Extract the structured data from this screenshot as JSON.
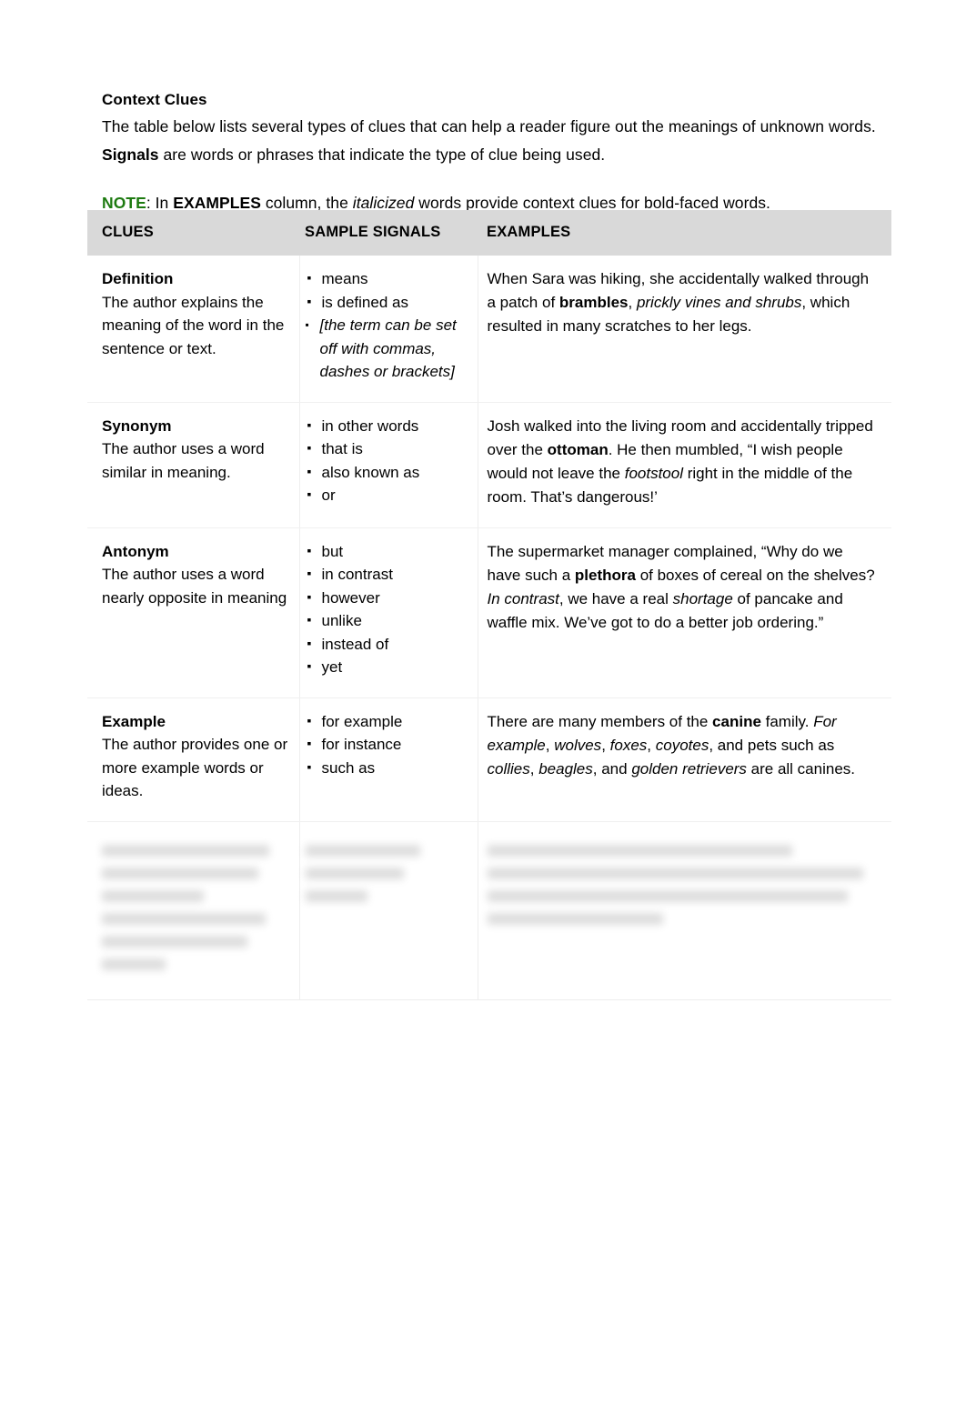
{
  "document": {
    "title": "Context Clues",
    "intro_part1": "The table below lists several types of clues that can help a reader figure out the meanings of unknown words.  ",
    "intro_bold": "Signals",
    "intro_part2": " are words or phrases that indicate the type of clue being used.",
    "note_label": "NOTE",
    "note_part1": ": In ",
    "note_bold": "EXAMPLES",
    "note_part2": " column, the ",
    "note_italic": "italicized",
    "note_part3": " words provide context clues for bold-faced words.",
    "note_color": "#1d7a10"
  },
  "table": {
    "headers": {
      "clues": "CLUES",
      "signals": "SAMPLE SIGNALS",
      "examples": "EXAMPLES"
    },
    "rows": [
      {
        "clue_name": "Definition",
        "clue_desc": "The author explains the meaning of the word in the sentence or text.",
        "signals": [
          {
            "text": "means",
            "italic": false
          },
          {
            "text": "is defined as",
            "italic": false
          },
          {
            "text": "[the term can be set off with commas, dashes or brackets]",
            "italic": true
          }
        ],
        "example": {
          "p1": "When Sara was hiking, she accidentally walked through a patch of ",
          "bold1": "brambles",
          "p2": ", ",
          "italic1": "prickly vines and shrubs",
          "p3": ", which resulted in many scratches to her legs."
        }
      },
      {
        "clue_name": "Synonym",
        "clue_desc": "The author uses a word similar in meaning.",
        "signals": [
          {
            "text": "in other words",
            "italic": false
          },
          {
            "text": "that is",
            "italic": false
          },
          {
            "text": "also known as",
            "italic": false
          },
          {
            "text": "or",
            "italic": false
          }
        ],
        "example": {
          "p1": "Josh walked into the living room and accidentally tripped over the ",
          "bold1": "ottoman",
          "p2": ".  He then mumbled, “I wish people would not leave the ",
          "italic1": "footstool",
          "p3": " right in the middle of the room.  That’s dangerous!’"
        }
      },
      {
        "clue_name": "Antonym",
        "clue_desc": "The author uses a word nearly opposite in meaning",
        "signals": [
          {
            "text": "but",
            "italic": false
          },
          {
            "text": "in contrast",
            "italic": false
          },
          {
            "text": "however",
            "italic": false
          },
          {
            "text": "unlike",
            "italic": false
          },
          {
            "text": "instead of",
            "italic": false
          },
          {
            "text": "yet",
            "italic": false
          }
        ],
        "example": {
          "p1": "The supermarket manager complained, “Why do we have such a ",
          "bold1": "plethora",
          "p2": " of boxes of cereal on the shelves?  ",
          "italic1": "In contrast",
          "p3": ", we have a real ",
          "italic2": "shortage",
          "p4": " of pancake and waffle mix. We’ve got to do a better job ordering.”"
        }
      },
      {
        "clue_name": "Example",
        "clue_desc": "The author provides one or more example words or ideas.",
        "signals": [
          {
            "text": "for example",
            "italic": false
          },
          {
            "text": "for instance",
            "italic": false
          },
          {
            "text": "such as",
            "italic": false
          }
        ],
        "example": {
          "p1": "There are many members of the ",
          "bold1": "canine",
          "p2": " family.  ",
          "italic1": "For example",
          "p3": ", ",
          "italic2": "wolves",
          "p4": ", ",
          "italic3": "foxes",
          "p5": ", ",
          "italic4": "coyotes",
          "p6": ", and pets such as ",
          "italic5": "collies",
          "p7": ", ",
          "italic6": "beagles",
          "p8": ", and ",
          "italic7": "golden retrievers",
          "p9": " are all canines."
        }
      }
    ],
    "obscured_row": {
      "status": "blurred-illegible",
      "clue_text": "",
      "signals_text": "",
      "example_text": ""
    }
  },
  "footer": {
    "text": ""
  }
}
